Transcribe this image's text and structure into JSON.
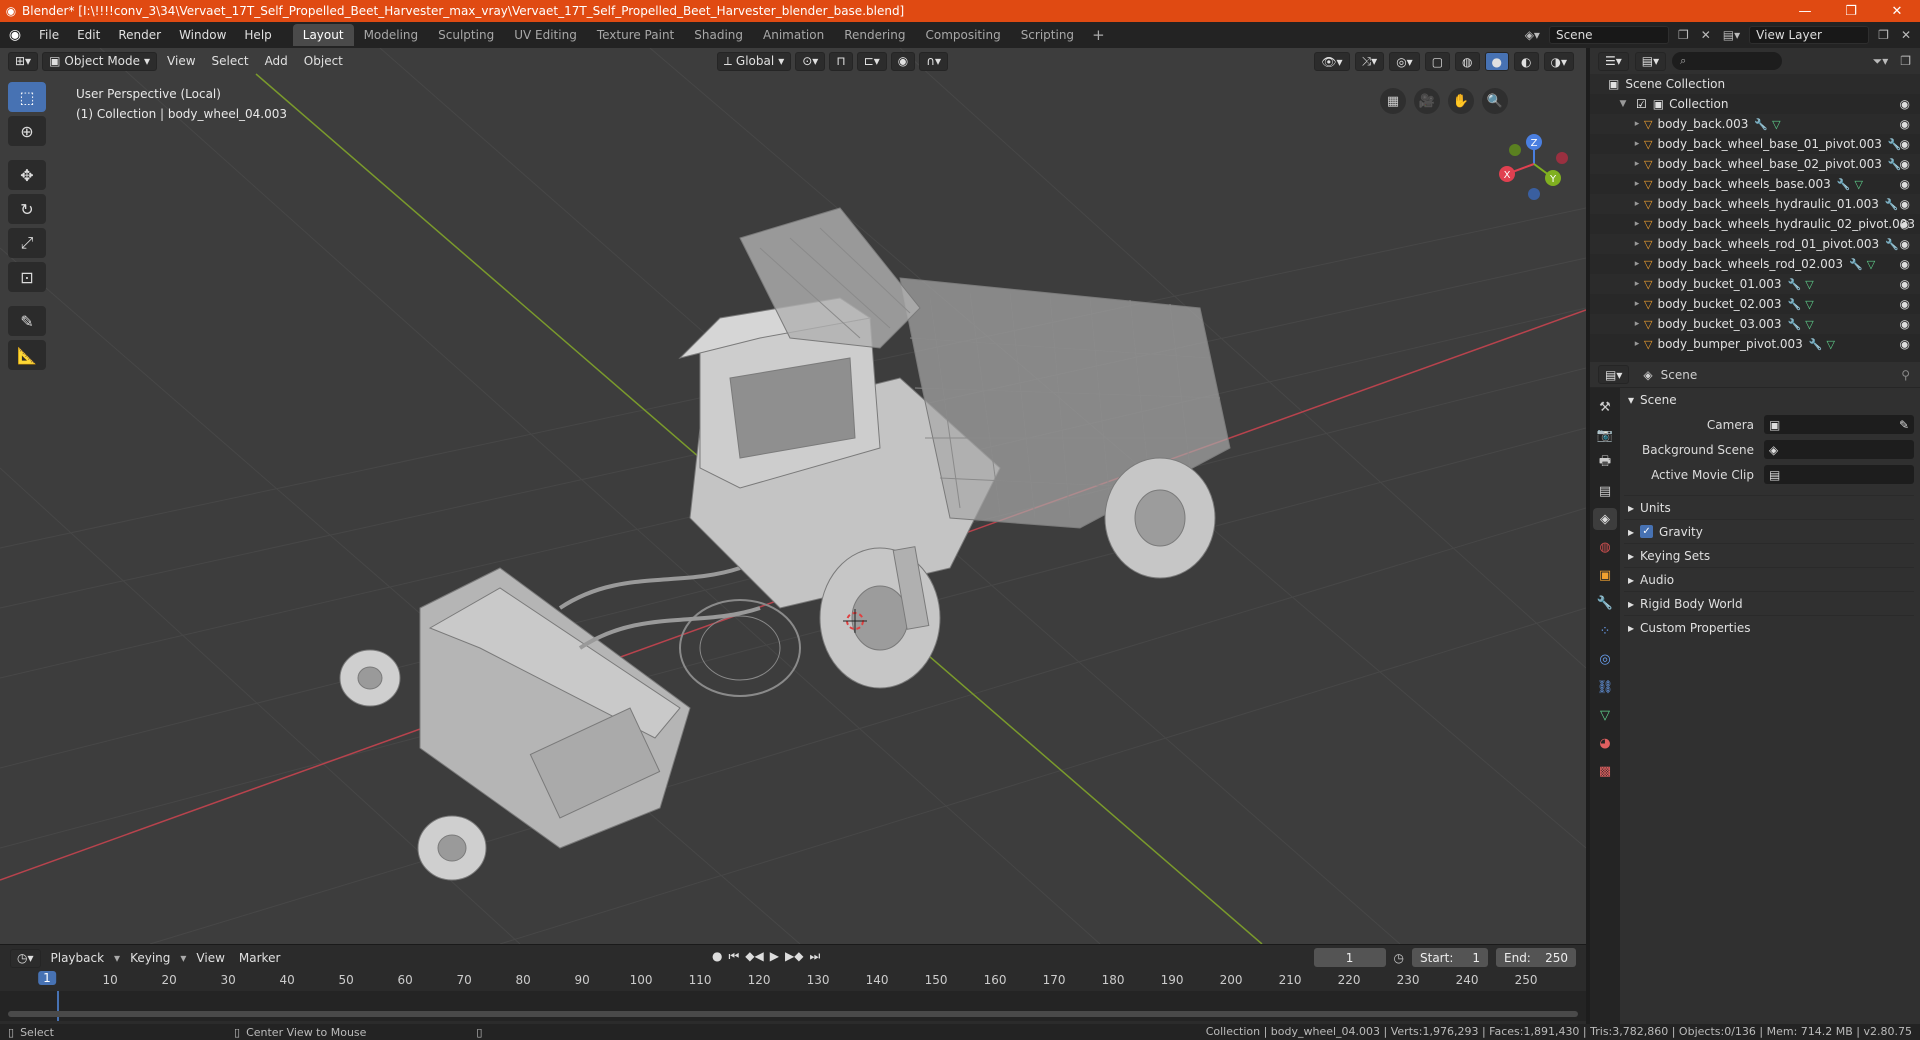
{
  "window": {
    "title": "Blender* [I:\\!!!!conv_3\\34\\Vervaet_17T_Self_Propelled_Beet_Harvester_max_vray\\Vervaet_17T_Self_Propelled_Beet_Harvester_blender_base.blend]",
    "minimize": "—",
    "maximize": "❐",
    "close": "✕"
  },
  "menu": {
    "items": [
      "File",
      "Edit",
      "Render",
      "Window",
      "Help"
    ],
    "workspaces": [
      "Layout",
      "Modeling",
      "Sculpting",
      "UV Editing",
      "Texture Paint",
      "Shading",
      "Animation",
      "Rendering",
      "Compositing",
      "Scripting"
    ],
    "active_workspace": "Layout",
    "add_workspace": "+",
    "scene_label": "Scene",
    "view_layer_label": "View Layer"
  },
  "viewport": {
    "mode": "Object Mode",
    "menus": [
      "View",
      "Select",
      "Add",
      "Object"
    ],
    "transform_orientation": "Global",
    "info_line1": "User Perspective (Local)",
    "info_line2": "(1) Collection | body_wheel_04.003",
    "gizmo_labels": {
      "x": "X",
      "y": "Y",
      "z": "Z"
    },
    "colors": {
      "background": "#3d3d3d",
      "x_axis": "#b8434d",
      "y_axis": "#7a9a2c",
      "grid": "#474747",
      "model": "#bdbdbd"
    }
  },
  "toolbar": {
    "tools": [
      "select-box-icon",
      "cursor-icon",
      "move-icon",
      "rotate-icon",
      "scale-icon",
      "transform-icon",
      "annotate-icon",
      "measure-icon"
    ]
  },
  "timeline": {
    "menus": [
      "Playback",
      "Keying",
      "View",
      "Marker"
    ],
    "current_frame": "1",
    "start_label": "Start:",
    "start_value": "1",
    "end_label": "End:",
    "end_value": "250",
    "ticks": [
      "10",
      "20",
      "30",
      "40",
      "50",
      "60",
      "70",
      "80",
      "90",
      "100",
      "110",
      "120",
      "130",
      "140",
      "150",
      "160",
      "170",
      "180",
      "190",
      "200",
      "210",
      "220",
      "230",
      "240",
      "250"
    ],
    "frame_marker": "1"
  },
  "statusbar": {
    "select": "Select",
    "center_view": "Center View to Mouse",
    "stats": "Collection | body_wheel_04.003 | Verts:1,976,293 | Faces:1,891,430 | Tris:3,782,860 | Objects:0/136 | Mem: 714.2 MB | v2.80.75"
  },
  "outliner": {
    "scene_collection": "Scene Collection",
    "collection": "Collection",
    "objects": [
      {
        "name": "body_back.003",
        "mod": true,
        "mesh": true
      },
      {
        "name": "body_back_wheel_base_01_pivot.003",
        "mod": true,
        "mesh": false
      },
      {
        "name": "body_back_wheel_base_02_pivot.003",
        "mod": true,
        "mesh": false
      },
      {
        "name": "body_back_wheels_base.003",
        "mod": true,
        "mesh": true
      },
      {
        "name": "body_back_wheels_hydraulic_01.003",
        "mod": true,
        "mesh": false
      },
      {
        "name": "body_back_wheels_hydraulic_02_pivot.003",
        "mod": false,
        "mesh": false
      },
      {
        "name": "body_back_wheels_rod_01_pivot.003",
        "mod": true,
        "mesh": false
      },
      {
        "name": "body_back_wheels_rod_02.003",
        "mod": true,
        "mesh": true
      },
      {
        "name": "body_bucket_01.003",
        "mod": true,
        "mesh": true
      },
      {
        "name": "body_bucket_02.003",
        "mod": true,
        "mesh": true
      },
      {
        "name": "body_bucket_03.003",
        "mod": true,
        "mesh": true
      },
      {
        "name": "body_bumper_pivot.003",
        "mod": true,
        "mesh": true
      }
    ]
  },
  "properties": {
    "context": "Scene",
    "panel": "Scene",
    "camera_label": "Camera",
    "background_scene_label": "Background Scene",
    "active_clip_label": "Active Movie Clip",
    "subpanels": [
      "Units",
      "Gravity",
      "Keying Sets",
      "Audio",
      "Rigid Body World",
      "Custom Properties"
    ]
  }
}
